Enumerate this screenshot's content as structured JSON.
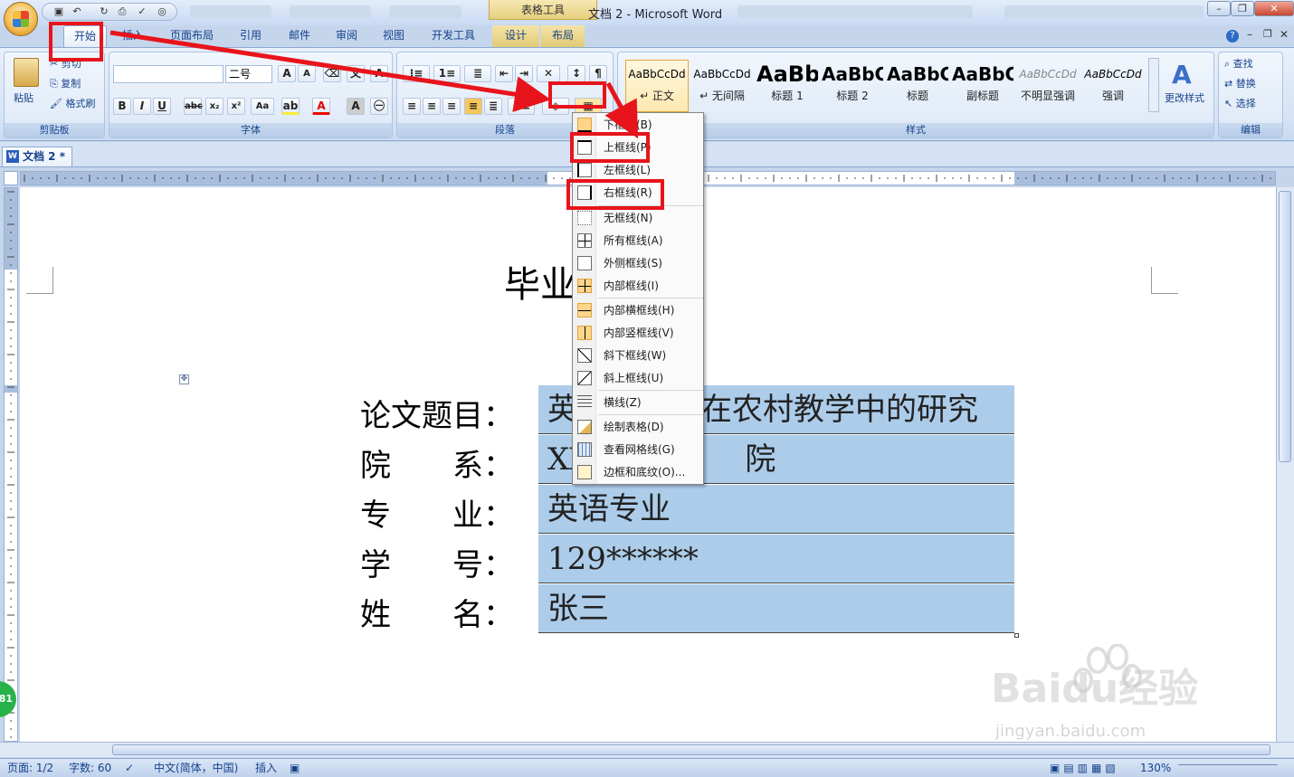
{
  "title_bar": {
    "context_tab": "表格工具",
    "window_title": "文档 2 - Microsoft Word"
  },
  "tabs": [
    "开始",
    "插入",
    "页面布局",
    "引用",
    "邮件",
    "审阅",
    "视图",
    "开发工具",
    "设计",
    "布局"
  ],
  "ribbon": {
    "clipboard": {
      "paste": "粘贴",
      "cut": "剪切",
      "copy": "复制",
      "format_painter": "格式刷",
      "label": "剪贴板"
    },
    "font": {
      "font_name": "",
      "font_size": "二号",
      "label": "字体"
    },
    "paragraph": {
      "label": "段落"
    },
    "styles": {
      "label": "样式",
      "items": [
        {
          "sample": "AaBbCcDd",
          "name": "↵ 正文"
        },
        {
          "sample": "AaBbCcDd",
          "name": "↵ 无间隔"
        },
        {
          "sample": "AaBb",
          "name": "标题 1"
        },
        {
          "sample": "AaBbC",
          "name": "标题 2"
        },
        {
          "sample": "AaBbC",
          "name": "标题"
        },
        {
          "sample": "AaBbC",
          "name": "副标题"
        },
        {
          "sample": "AaBbCcDd",
          "name": "不明显强调"
        },
        {
          "sample": "AaBbCcDd",
          "name": "强调"
        }
      ],
      "change_styles": "更改样式"
    },
    "editing": {
      "find": "查找",
      "replace": "替换",
      "select": "选择",
      "label": "编辑"
    }
  },
  "doc_tab": "文档 2 *",
  "document": {
    "title": "毕业",
    "rows": [
      {
        "label": "论文题目：",
        "value": "英　　　　在农村教学中的研究"
      },
      {
        "label": "院　　系：",
        "value": "XX　　　　　院"
      },
      {
        "label": "专　　业：",
        "value": "英语专业"
      },
      {
        "label": "学　　号：",
        "value": "129******"
      },
      {
        "label": "姓　　名：",
        "value": "张三"
      }
    ]
  },
  "border_menu": {
    "items": [
      {
        "label": "下框线(B)",
        "icon": "bottom-border-icon"
      },
      {
        "label": "上框线(P)",
        "icon": "top-border-icon"
      },
      {
        "label": "左框线(L)",
        "icon": "left-border-icon"
      },
      {
        "label": "右框线(R)",
        "icon": "right-border-icon"
      },
      {
        "label": "无框线(N)",
        "icon": "no-border-icon"
      },
      {
        "label": "所有框线(A)",
        "icon": "all-borders-icon"
      },
      {
        "label": "外侧框线(S)",
        "icon": "outside-borders-icon"
      },
      {
        "label": "内部框线(I)",
        "icon": "inside-borders-icon"
      },
      {
        "label": "内部横框线(H)",
        "icon": "inside-horizontal-border-icon"
      },
      {
        "label": "内部竖框线(V)",
        "icon": "inside-vertical-border-icon"
      },
      {
        "label": "斜下框线(W)",
        "icon": "diagonal-down-border-icon"
      },
      {
        "label": "斜上框线(U)",
        "icon": "diagonal-up-border-icon"
      },
      {
        "label": "横线(Z)",
        "icon": "horizontal-line-icon"
      },
      {
        "label": "绘制表格(D)",
        "icon": "draw-table-icon"
      },
      {
        "label": "查看网格线(G)",
        "icon": "view-gridlines-icon"
      },
      {
        "label": "边框和底纹(O)...",
        "icon": "borders-shading-icon"
      }
    ]
  },
  "status_bar": {
    "page": "页面: 1/2",
    "words": "字数: 60",
    "language": "中文(简体，中国)",
    "mode": "插入",
    "zoom": "130%"
  },
  "watermark": {
    "text": "Baidu经验",
    "url": "jingyan.baidu.com"
  },
  "badge": "81",
  "colors": {
    "annotation": "#e8141b",
    "table_fill": "#acccea",
    "ribbon": "#dde8f6"
  }
}
